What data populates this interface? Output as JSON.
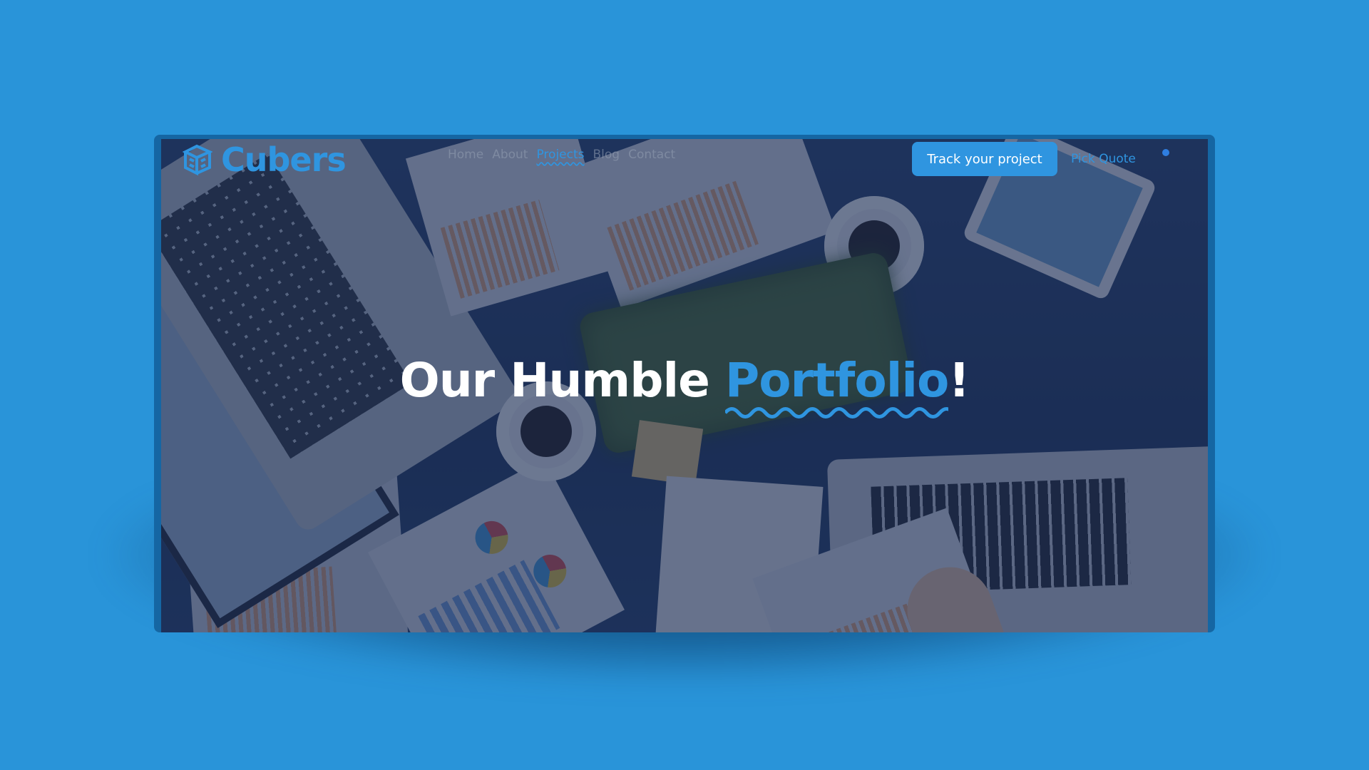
{
  "brand": {
    "name": "Cubers",
    "icon": "cube-stack-icon",
    "color": "#2f95e0"
  },
  "nav": {
    "items": [
      {
        "label": "Home",
        "active": false
      },
      {
        "label": "About",
        "active": false
      },
      {
        "label": "Projects",
        "active": true
      },
      {
        "label": "Blog",
        "active": false
      },
      {
        "label": "Contact",
        "active": false
      }
    ],
    "track_button": "Track your project",
    "quote_link": "Pick Quote"
  },
  "hero": {
    "title_prefix": "Our Humble ",
    "title_highlight": "Portfolio",
    "title_suffix": "!"
  },
  "colors": {
    "background": "#2994d9",
    "accent": "#2f95e0",
    "frame": "#1566a3"
  }
}
